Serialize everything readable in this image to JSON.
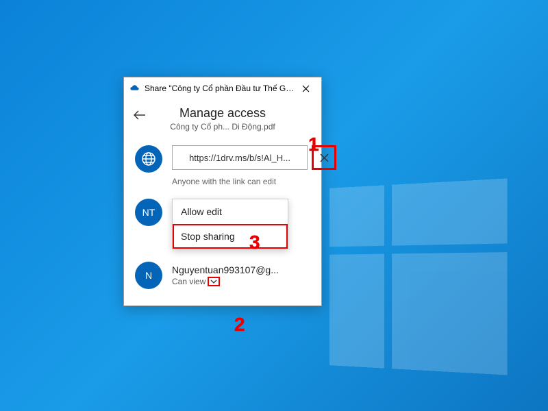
{
  "titlebar": {
    "title": "Share \"Công ty Cổ phần Đầu tư Thế Giới Di Độ..."
  },
  "header": {
    "title": "Manage access",
    "subtitle": "Công ty Cổ ph... Di Động.pdf"
  },
  "link": {
    "url": "https://1drv.ms/b/s!Al_H...",
    "description": "Anyone with the link can edit"
  },
  "menu": {
    "allow_edit": "Allow edit",
    "stop_sharing": "Stop sharing"
  },
  "people": {
    "nt": {
      "initials": "NT"
    },
    "n": {
      "initials": "N",
      "name": "Nguyentuan993107@g...",
      "permission": "Can view"
    }
  },
  "annotations": {
    "one": "1",
    "two": "2",
    "three": "3"
  }
}
